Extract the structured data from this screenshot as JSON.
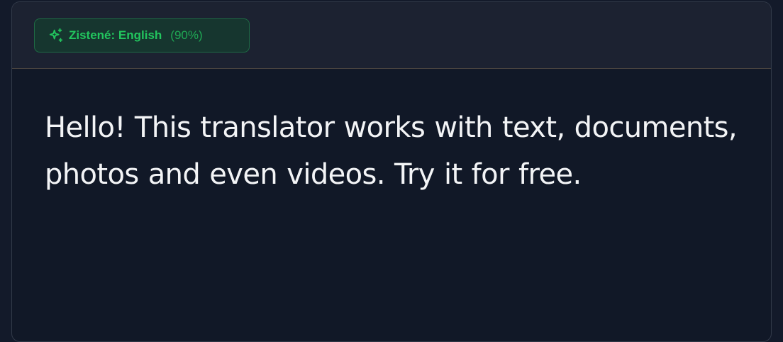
{
  "detection": {
    "label": "Zistené: English",
    "confidence": "(90%)",
    "icon": "sparkles-icon",
    "accent_color": "#22c55e"
  },
  "source": {
    "text": "Hello! This translator works with text, documents, photos and even videos. Try it for free."
  },
  "colors": {
    "background": "#111827",
    "header_background": "#1c2231",
    "text": "#f3f4f6"
  }
}
